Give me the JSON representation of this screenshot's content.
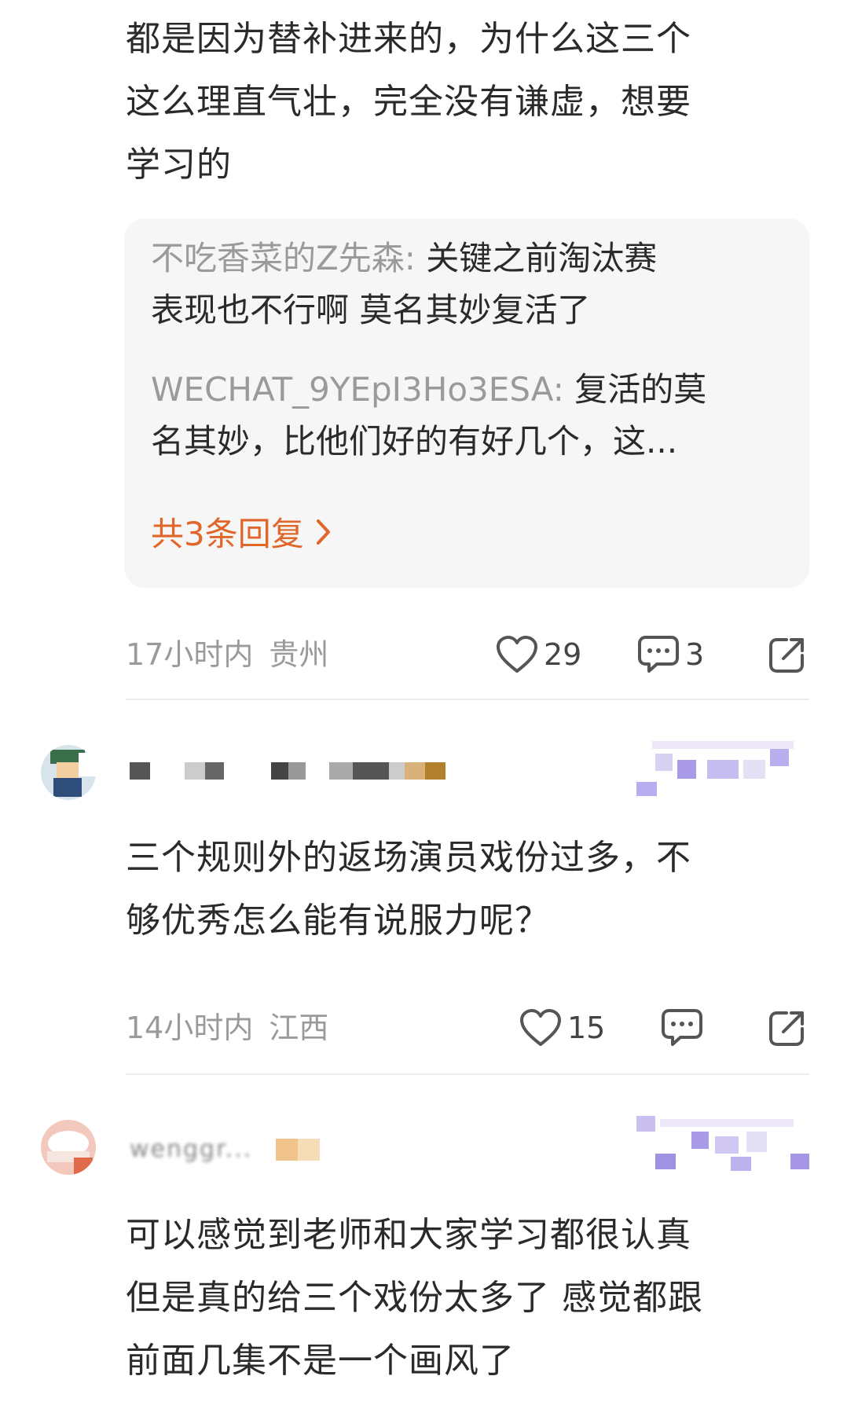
{
  "comment1": {
    "lines": [
      "都是因为替补进来的，为什么这三个",
      "这么理直气壮，完全没有谦虚，想要",
      "学习的"
    ],
    "replies": [
      {
        "author": "不吃香菜的Z先森:",
        "text_line1": " 关键之前淘汰赛",
        "text_line2": "表现也不行啊  莫名其妙复活了"
      },
      {
        "author": "WECHAT_9YEpI3Ho3ESA:",
        "text_line1": " 复活的莫",
        "text_line2": "名其妙，比他们好的有好几个，这..."
      }
    ],
    "more_replies": "共3条回复",
    "time": "17小时内",
    "location": "贵州",
    "likes": "29",
    "comments": "3"
  },
  "comment2": {
    "lines": [
      "三个规则外的返场演员戏份过多，不",
      "够优秀怎么能有说服力呢？"
    ],
    "time": "14小时内",
    "location": "江西",
    "likes": "15"
  },
  "comment3": {
    "username_partial": "wenggr...",
    "lines": [
      "可以感觉到老师和大家学习都很认真",
      "但是真的给三个戏份太多了 感觉都跟",
      "前面几集不是一个画风了"
    ]
  },
  "icons": {
    "like": "heart-outline-icon",
    "comment": "speech-bubble-icon",
    "share": "share-arrow-icon",
    "chevron": "chevron-right-icon"
  },
  "colors": {
    "accent": "#e0662a",
    "muted": "#9a9a9a",
    "reply_bg": "#f6f6f6"
  }
}
